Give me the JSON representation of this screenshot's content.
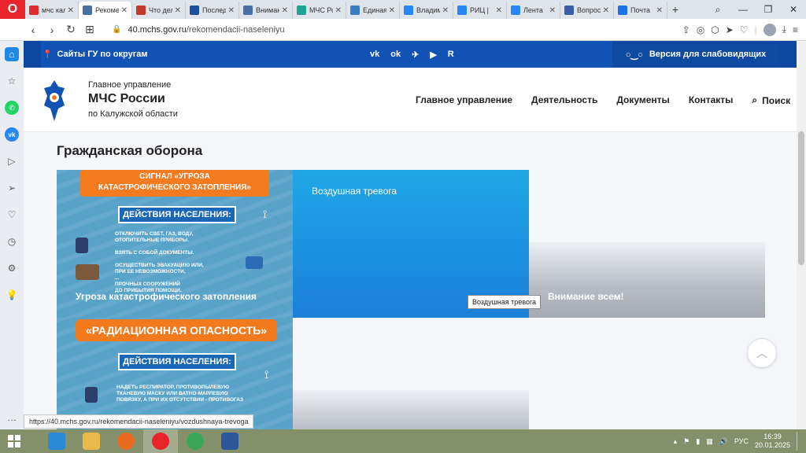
{
  "browser": {
    "tabs": [
      {
        "title": "мчс калужской",
        "color": "#e02b2b",
        "active": false
      },
      {
        "title": "Рекомендации",
        "color": "#4a6fa5",
        "active": true
      },
      {
        "title": "Что делать",
        "color": "#c0392b",
        "active": false
      },
      {
        "title": "Последние",
        "color": "#1e4f9c",
        "active": false
      },
      {
        "title": "Внимание",
        "color": "#4a6fa5",
        "active": false
      },
      {
        "title": "МЧС России",
        "color": "#20a38f",
        "active": false
      },
      {
        "title": "Единая",
        "color": "#3b7cc4",
        "active": false
      },
      {
        "title": "Владимир",
        "color": "#2787f5",
        "active": false
      },
      {
        "title": "РИЦ |",
        "color": "#2787f5",
        "active": false
      },
      {
        "title": "Лента",
        "color": "#2787f5",
        "active": false
      },
      {
        "title": "Вопросы",
        "color": "#3b5ea8",
        "active": false
      },
      {
        "title": "Почта",
        "color": "#1c73e8",
        "active": false
      }
    ],
    "new_tab": "+",
    "url_host": "40.mchs.gov.ru",
    "url_path": "/rekomendacii-naseleniyu"
  },
  "site": {
    "topstrip": {
      "regions": "Сайты ГУ по округам",
      "socials": [
        "vk",
        "ok",
        "tg",
        "yt",
        "R"
      ],
      "access": "Версия для слабовидящих"
    },
    "org": {
      "line1": "Главное управление",
      "line2": "МЧС России",
      "line3": "по Калужской области"
    },
    "nav": [
      "Главное управление",
      "Деятельность",
      "Документы",
      "Контакты"
    ],
    "search": "Поиск",
    "section_title": "Гражданская оборона",
    "cards": {
      "flood": {
        "banner_line1": "СИГНАЛ «УГРОЗА",
        "banner_line2": "КАТАСТРОФИЧЕСКОГО ЗАТОПЛЕНИЯ»",
        "actions": "ДЕЙСТВИЯ НАСЕЛЕНИЯ:",
        "instructions": [
          "ОТКЛЮЧИТЬ СВЕТ, ГАЗ, ВОДУ,",
          "ОТОПИТЕЛЬНЫЕ ПРИБОРЫ.",
          "",
          "ВЗЯТЬ С СОБОЙ ДОКУМЕНТЫ.",
          "",
          "ОСУЩЕСТВИТЬ ЭВАКУАЦИЮ ИЛИ,",
          "ПРИ ЕЕ НЕВОЗМОЖНОСТИ,",
          "...",
          "ПРОЧНЫХ СООРУЖЕНИЙ",
          "ДО ПРИБЫТИЯ ПОМОЩИ."
        ],
        "caption": "Угроза катастрофического затопления"
      },
      "airraid": {
        "caption": "Воздушная тревога",
        "tooltip": "Воздушная тревога"
      },
      "attention": {
        "caption": "Внимание всем!"
      },
      "radiation": {
        "banner": "«РАДИАЦИОННАЯ ОПАСНОСТЬ»",
        "actions": "ДЕЙСТВИЯ НАСЕЛЕНИЯ:",
        "instructions": [
          "НАДЕТЬ РЕСПИРАТОР, ПРОТИВОПЫЛЕВУЮ",
          "ТКАНЕВУЮ МАСКУ ИЛИ ВАТНО-МАРЛЕВУЮ",
          "ПОВЯЗКУ, А ПРИ ИХ ОТСУТСТВИИ - ПРОТИВОГАЗ"
        ]
      }
    }
  },
  "status_url": "https://40.mchs.gov.ru/rekomendacii-naseleniyu/vozdushnaya-trevoga",
  "taskbar": {
    "apps": [
      {
        "name": "ie",
        "color": "#2b8ad8"
      },
      {
        "name": "explorer",
        "color": "#e8b84a"
      },
      {
        "name": "firefox",
        "color": "#e86a1f"
      },
      {
        "name": "opera",
        "color": "#e8232a"
      },
      {
        "name": "chrome",
        "color": "#3aa757"
      },
      {
        "name": "word",
        "color": "#2b579a"
      }
    ],
    "lang": "РУС",
    "time": "16:39",
    "date": "20.01.2025"
  }
}
